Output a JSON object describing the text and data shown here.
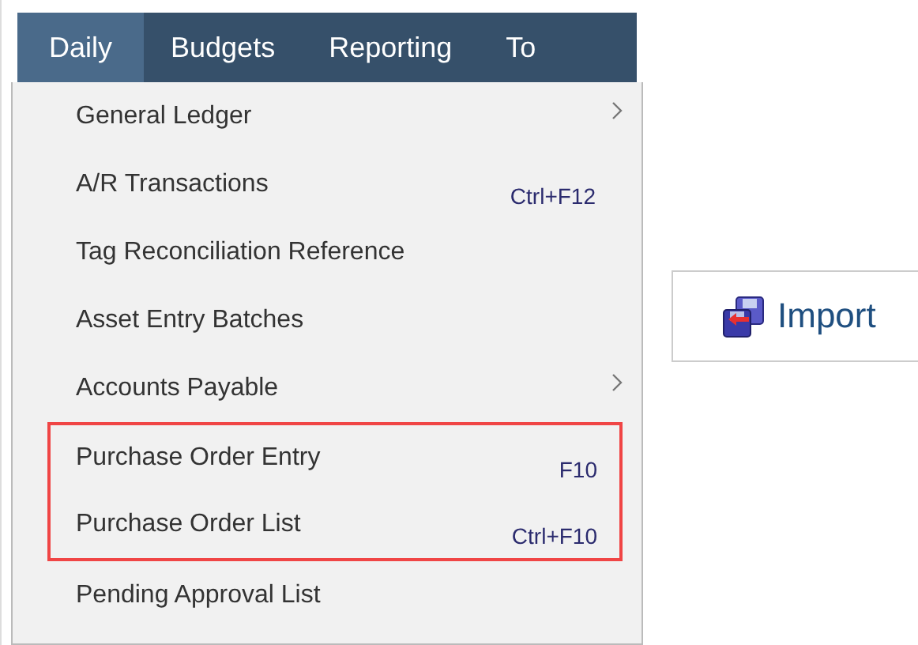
{
  "menu_bar": [
    {
      "label": "Daily",
      "selected": true
    },
    {
      "label": "Budgets",
      "selected": false
    },
    {
      "label": "Reporting",
      "selected": false
    },
    {
      "label": "To",
      "selected": false
    }
  ],
  "dropdown": {
    "sections": [
      {
        "highlighted": false,
        "items": [
          {
            "label": "General Ledger",
            "kind": "submenu"
          },
          {
            "label": "A/R Transactions",
            "kind": "command",
            "shortcut": "Ctrl+F12"
          },
          {
            "label": "Tag Reconciliation Reference",
            "kind": "command"
          },
          {
            "label": "Asset Entry Batches",
            "kind": "command"
          },
          {
            "label": "Accounts Payable",
            "kind": "submenu"
          }
        ]
      },
      {
        "highlighted": true,
        "items": [
          {
            "label": "Purchase Order Entry",
            "kind": "command",
            "shortcut": "F10"
          },
          {
            "label": "Purchase Order List",
            "kind": "command",
            "shortcut": "Ctrl+F10"
          }
        ]
      },
      {
        "highlighted": false,
        "items": [
          {
            "label": "Pending Approval List",
            "kind": "command"
          }
        ]
      }
    ]
  },
  "import_button": {
    "label": "Import"
  }
}
